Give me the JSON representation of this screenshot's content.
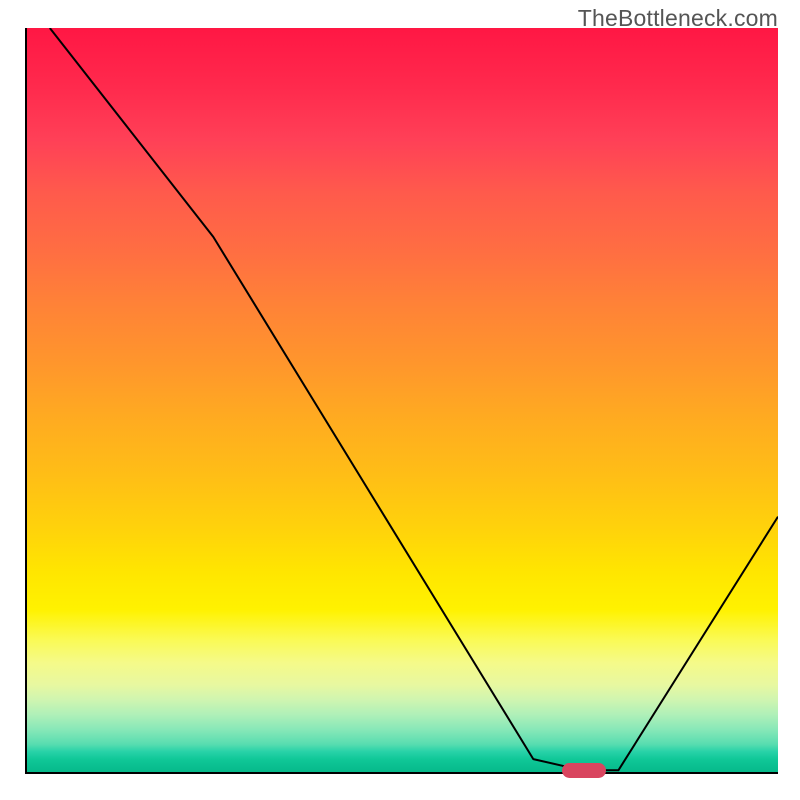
{
  "watermark": "TheBottleneck.com",
  "chart_data": {
    "type": "line",
    "title": "",
    "xlabel": "",
    "ylabel": "",
    "xlim": [
      0,
      100
    ],
    "ylim": [
      0,
      100
    ],
    "x": [
      3.3,
      25.0,
      67.5,
      74.0,
      78.8,
      100.0
    ],
    "y": [
      100.0,
      72.0,
      2.0,
      0.5,
      0.5,
      34.5
    ],
    "marker_x": 74.3,
    "marker_y": 0.5,
    "gradient_colors": {
      "top": "#ff1744",
      "mid": "#ffd000",
      "bottom": "#05b888"
    },
    "annotations": []
  }
}
